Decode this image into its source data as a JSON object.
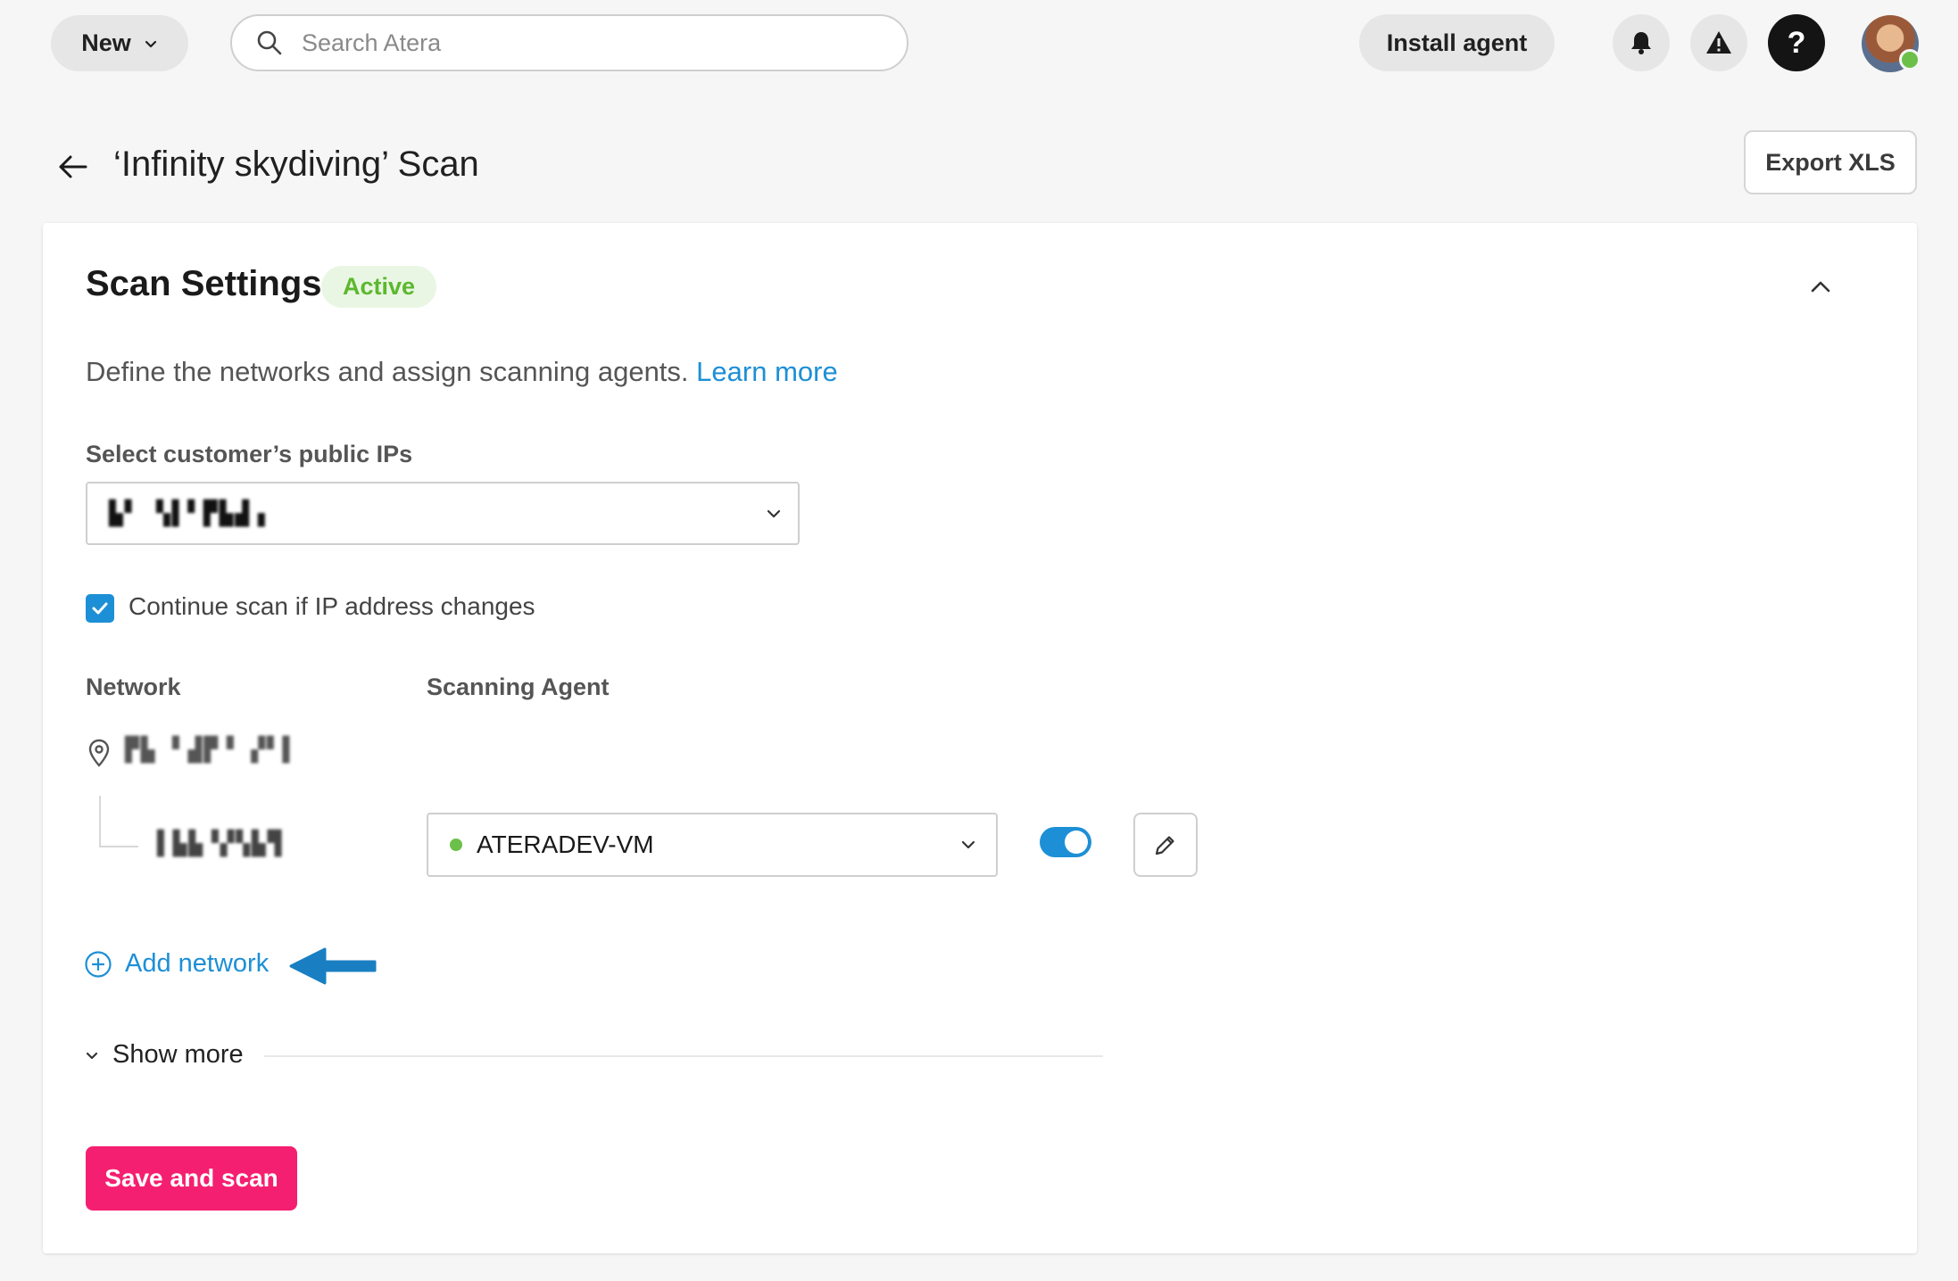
{
  "topbar": {
    "new_label": "New",
    "search_placeholder": "Search Atera",
    "install_label": "Install agent",
    "help_label": "?"
  },
  "header": {
    "title": "‘Infinity skydiving’ Scan",
    "export_label": "Export XLS"
  },
  "scan_settings": {
    "title": "Scan Settings",
    "status_badge": "Active",
    "description": "Define the networks and assign scanning agents.",
    "learn_more": "Learn more",
    "public_ips_label": "Select customer’s public IPs",
    "continue_scan_label": "Continue scan if IP address changes",
    "continue_scan_checked": true,
    "columns": {
      "network": "Network",
      "scanning_agent": "Scanning Agent"
    },
    "agent": {
      "name": "ATERADEV-VM",
      "status_color": "#6cc04a",
      "enabled": true
    },
    "add_network": "Add network",
    "show_more": "Show more",
    "save_label": "Save and scan"
  },
  "colors": {
    "accent_blue": "#1d8fd6",
    "save_pink": "#f51f71",
    "active_green": "#5cb82e",
    "annotation_arrow": "#1a7fc2"
  },
  "icons": {
    "search": "search-icon",
    "bell": "bell-icon",
    "alert": "warning-icon",
    "location": "location-pin-icon",
    "edit": "pencil-icon",
    "add": "plus-circle-icon"
  }
}
